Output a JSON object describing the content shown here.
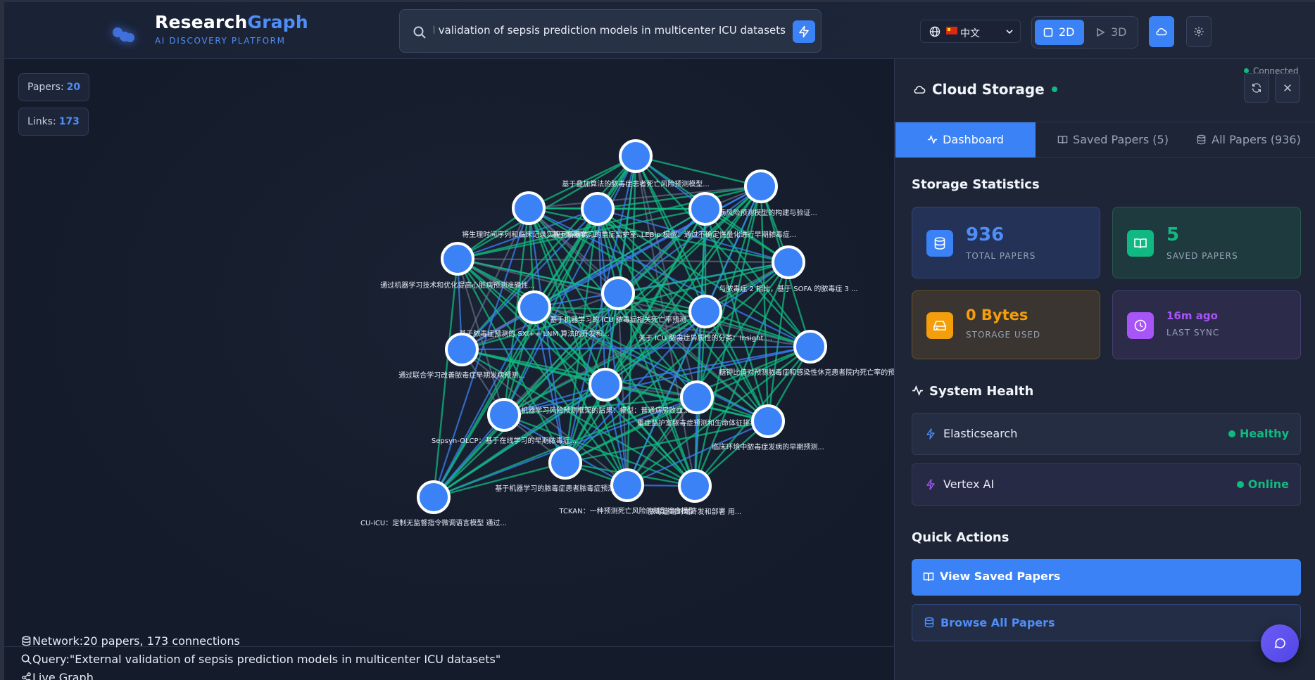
{
  "app": {
    "brand_main": "Research",
    "brand_accent": "Graph",
    "brand_subtitle": "AI DISCOVERY PLATFORM"
  },
  "search": {
    "value": "External validation of sepsis prediction models in multicenter ICU datasets",
    "icon": "search-icon",
    "submit_icon": "lightning-icon"
  },
  "language": {
    "label": "中文",
    "flag": "cn-flag-icon",
    "icon": "globe-icon"
  },
  "view_toggle": {
    "option_2d": "2D",
    "option_3d": "3D",
    "active": "2D"
  },
  "graph": {
    "papers_label": "Papers:",
    "papers_count": "20",
    "links_label": "Links:",
    "links_count": "173",
    "nodes": [
      {
        "label": "基于叠加算法的脓毒症患者死亡风险预测模型..."
      },
      {
        "label": "糖尿病风险预测模型的构建与验证..."
      },
      {
        "label": "将生理时间序列和临床记录实现可解释的..."
      },
      {
        "label": "基于机器学习的重症监护室..."
      },
      {
        "label": "LEBip 模型：通过不确定性量化进行早期脓毒症..."
      },
      {
        "label": "通过机器学习技术和优化提高心脏病预测准确性..."
      },
      {
        "label": "与脓毒症 2 相比，基于 SOFA 的脓毒症 3 ..."
      },
      {
        "label": "基于机器学习的 ICU 脓毒症相关死亡率预测"
      },
      {
        "label": "基于脓毒症预测的 SXI++ LNM 算法的开发和..."
      },
      {
        "label": "关于 ICU 脓毒症异质性的分类：Insight ..."
      },
      {
        "label": "通过联合学习改善脓毒症早期发病预测..."
      },
      {
        "label": "糖钾比值对预测脓毒症和感染性休克患者院内死亡率的预..."
      },
      {
        "label": "机器学习风险预测框架的后果：模型：普通病房败血..."
      },
      {
        "label": "重症监护室脓毒症预测和生命体征排名"
      },
      {
        "label": "Sepsyn-OLCP：基于在线学习的早期脓毒症..."
      },
      {
        "label": "临床环境中脓毒症发病的早期预测..."
      },
      {
        "label": "基于机器学习的脓毒症患者脓毒症预测模型..."
      },
      {
        "label": "TCKAN：一种预测死亡风险的新型综合模型"
      },
      {
        "label": "CU-ICU：定制无监督指令微调语言模型   通过..."
      },
      {
        "label": "脓毒症端到端开发和部署   用..."
      }
    ]
  },
  "footer": {
    "network_text": "Network:20 papers, 173 connections",
    "query_text": "Query:\"External validation of sepsis prediction models in multicenter ICU datasets\"",
    "live_text": "Live Graph"
  },
  "panel": {
    "connection_status": "Connected",
    "title": "Cloud Storage",
    "tabs": [
      {
        "label": "Dashboard",
        "icon": "activity-icon",
        "active": true
      },
      {
        "label": "Saved Papers (5)",
        "icon": "book-icon",
        "active": false
      },
      {
        "label": "All Papers (936)",
        "icon": "database-icon",
        "active": false
      }
    ],
    "storage_stats_title": "Storage Statistics",
    "stats": {
      "total_value": "936",
      "total_label": "TOTAL PAPERS",
      "saved_value": "5",
      "saved_label": "SAVED PAPERS",
      "used_value": "0 Bytes",
      "used_label": "STORAGE USED",
      "sync_value": "16m ago",
      "sync_label": "LAST SYNC"
    },
    "system_health_title": "System Health",
    "health": [
      {
        "name": "Elasticsearch",
        "status": "Healthy"
      },
      {
        "name": "Vertex AI",
        "status": "Online"
      }
    ],
    "quick_actions_title": "Quick Actions",
    "actions": {
      "view_saved": "View Saved Papers",
      "browse_all": "Browse All Papers"
    }
  },
  "colors": {
    "accent": "#3b82f6",
    "success": "#10b981",
    "warning": "#f59e0b",
    "purple": "#a855f7",
    "edge_green": "#10b981",
    "edge_blue": "#3b82f6",
    "edge_gray": "#6b7a94"
  }
}
